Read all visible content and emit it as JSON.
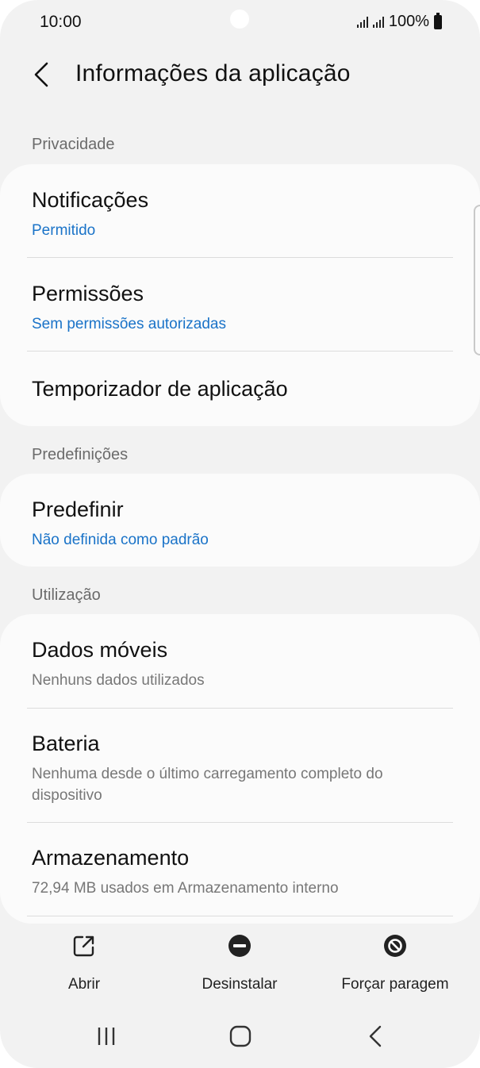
{
  "status_bar": {
    "time": "10:00",
    "battery": "100%"
  },
  "header": {
    "title": "Informações da aplicação"
  },
  "sections": {
    "privacy": {
      "label": "Privacidade",
      "items": [
        {
          "title": "Notificações",
          "subtitle": "Permitido"
        },
        {
          "title": "Permissões",
          "subtitle": "Sem permissões autorizadas"
        },
        {
          "title": "Temporizador de aplicação"
        }
      ]
    },
    "defaults": {
      "label": "Predefinições",
      "items": [
        {
          "title": "Predefinir",
          "subtitle": "Não definida como padrão"
        }
      ]
    },
    "usage": {
      "label": "Utilização",
      "items": [
        {
          "title": "Dados móveis",
          "subtitle": "Nenhuns dados utilizados"
        },
        {
          "title": "Bateria",
          "subtitle": "Nenhuma desde o último carregamento completo do dispositivo"
        },
        {
          "title": "Armazenamento",
          "subtitle": "72,94 MB usados em Armazenamento interno"
        }
      ]
    }
  },
  "actions": {
    "open": {
      "label": "Abrir",
      "icon": "open-external-icon"
    },
    "uninstall": {
      "label": "Desinstalar",
      "icon": "minus-circle-icon"
    },
    "force_stop": {
      "label": "Forçar paragem",
      "icon": "block-icon"
    }
  },
  "colors": {
    "accent": "#1a73c8",
    "background": "#f2f2f2",
    "card": "#fbfbfb",
    "secondary_text": "#777777"
  }
}
